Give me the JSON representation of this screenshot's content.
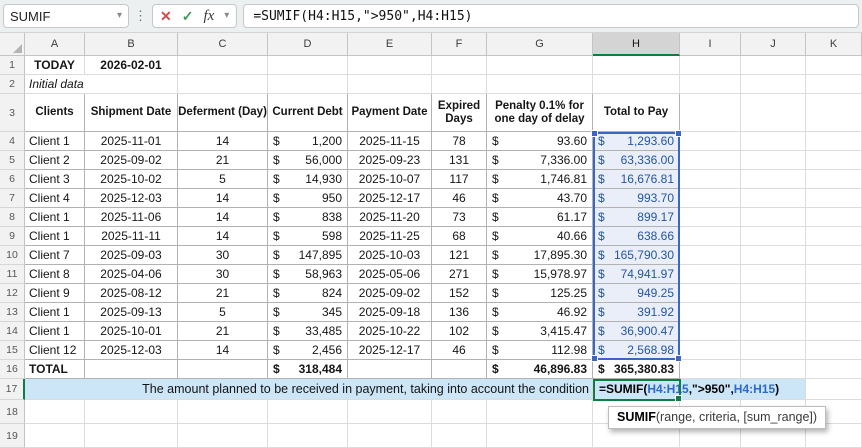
{
  "formula_bar": {
    "name_box": "SUMIF",
    "formula": "=SUMIF(H4:H15,\">950\",H4:H15)"
  },
  "icons": {
    "cancel": "✕",
    "confirm": "✓",
    "fx": "fx",
    "chevron": "▾",
    "dots": "⋮"
  },
  "grid": {
    "col_letters": [
      "A",
      "B",
      "C",
      "D",
      "E",
      "F",
      "G",
      "H",
      "I",
      "J",
      "K"
    ],
    "row_numbers": [
      "1",
      "2",
      "3",
      "4",
      "5",
      "6",
      "7",
      "8",
      "9",
      "10",
      "11",
      "12",
      "13",
      "14",
      "15",
      "16",
      "17",
      "18",
      "19"
    ]
  },
  "info": {
    "label": "TODAY",
    "date": "2026-02-01",
    "note": "Initial data"
  },
  "sheet": {
    "currency": "$"
  },
  "table": {
    "headers": [
      "Clients",
      "Shipment Date",
      "Deferment (Day)",
      "Current Debt",
      "Payment Date",
      "Expired Days",
      "Penalty 0.1% for one day of delay",
      "Total to Pay"
    ],
    "rows": [
      {
        "client": "Client 1",
        "shipment": "2025-11-01",
        "deferment": "14",
        "debt": "1,200",
        "payment": "2025-11-15",
        "expired": "78",
        "penalty": "93.60",
        "total": "1,293.60"
      },
      {
        "client": "Client 2",
        "shipment": "2025-09-02",
        "deferment": "21",
        "debt": "56,000",
        "payment": "2025-09-23",
        "expired": "131",
        "penalty": "7,336.00",
        "total": "63,336.00"
      },
      {
        "client": "Client 3",
        "shipment": "2025-10-02",
        "deferment": "5",
        "debt": "14,930",
        "payment": "2025-10-07",
        "expired": "117",
        "penalty": "1,746.81",
        "total": "16,676.81"
      },
      {
        "client": "Client 4",
        "shipment": "2025-12-03",
        "deferment": "14",
        "debt": "950",
        "payment": "2025-12-17",
        "expired": "46",
        "penalty": "43.70",
        "total": "993.70"
      },
      {
        "client": "Client 1",
        "shipment": "2025-11-06",
        "deferment": "14",
        "debt": "838",
        "payment": "2025-11-20",
        "expired": "73",
        "penalty": "61.17",
        "total": "899.17"
      },
      {
        "client": "Client 1",
        "shipment": "2025-11-11",
        "deferment": "14",
        "debt": "598",
        "payment": "2025-11-25",
        "expired": "68",
        "penalty": "40.66",
        "total": "638.66"
      },
      {
        "client": "Client 7",
        "shipment": "2025-09-03",
        "deferment": "30",
        "debt": "147,895",
        "payment": "2025-10-03",
        "expired": "121",
        "penalty": "17,895.30",
        "total": "165,790.30"
      },
      {
        "client": "Client 8",
        "shipment": "2025-04-06",
        "deferment": "30",
        "debt": "58,963",
        "payment": "2025-05-06",
        "expired": "271",
        "penalty": "15,978.97",
        "total": "74,941.97"
      },
      {
        "client": "Client 9",
        "shipment": "2025-08-12",
        "deferment": "21",
        "debt": "824",
        "payment": "2025-09-02",
        "expired": "152",
        "penalty": "125.25",
        "total": "949.25"
      },
      {
        "client": "Client 1",
        "shipment": "2025-09-13",
        "deferment": "5",
        "debt": "345",
        "payment": "2025-09-18",
        "expired": "136",
        "penalty": "46.92",
        "total": "391.92"
      },
      {
        "client": "Client 1",
        "shipment": "2025-10-01",
        "deferment": "21",
        "debt": "33,485",
        "payment": "2025-10-22",
        "expired": "102",
        "penalty": "3,415.47",
        "total": "36,900.47"
      },
      {
        "client": "Client 12",
        "shipment": "2025-12-03",
        "deferment": "14",
        "debt": "2,456",
        "payment": "2025-12-17",
        "expired": "46",
        "penalty": "112.98",
        "total": "2,568.98"
      }
    ],
    "total_row": {
      "label": "TOTAL",
      "debt": "318,484",
      "penalty": "46,896.83",
      "total": "365,380.83"
    },
    "banner": "The amount planned to be received in payment, taking into account the condition"
  },
  "cell_formula": {
    "p1": "=SUMIF(",
    "ref1": "H4:H15",
    "p2": ",\">950\",",
    "ref2": "H4:H15",
    "p3": ")"
  },
  "tooltip": {
    "function": "SUMIF",
    "signature": "(range, criteria, [sum_range])"
  },
  "colors": {
    "accent_green": "#107C41",
    "selection_border_blue": "#3b66c4",
    "selection_fill": "#e9eef8",
    "row17_fill": "#cde6f7",
    "formula_ref_blue": "#2e68c8",
    "total_column_text": "#2456a0"
  }
}
